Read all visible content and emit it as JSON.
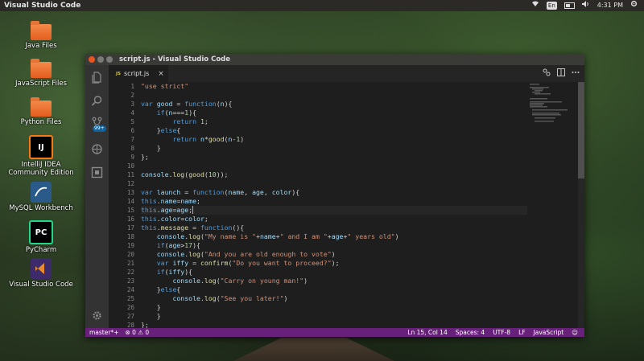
{
  "topbar": {
    "app_title": "Visual Studio Code",
    "keyboard": "En",
    "time": "4:31 PM"
  },
  "desktop": [
    {
      "label": "Java Files",
      "icon": "folder-icon"
    },
    {
      "label": "JavaScript Files",
      "icon": "folder-icon"
    },
    {
      "label": "Python Files",
      "icon": "folder-icon"
    },
    {
      "label": "IntelliJ IDEA Community Edition",
      "icon": "intellij-icon"
    },
    {
      "label": "MySQL Workbench",
      "icon": "mysql-icon"
    },
    {
      "label": "PyCharm",
      "icon": "pycharm-icon"
    },
    {
      "label": "Visual Studio Code",
      "icon": "vscode-icon"
    }
  ],
  "window": {
    "title": "script.js - Visual Studio Code",
    "tab": {
      "badge": "JS",
      "name": "script.js",
      "close": "×"
    },
    "scm_badge": "99+"
  },
  "code": {
    "lines": [
      "1",
      "2",
      "3",
      "4",
      "5",
      "6",
      "7",
      "8",
      "9",
      "10",
      "11",
      "12",
      "13",
      "14",
      "15",
      "16",
      "17",
      "18",
      "19",
      "20",
      "21",
      "22",
      "23",
      "24",
      "25",
      "26",
      "27",
      "28"
    ]
  },
  "statusbar": {
    "branch": "master*+",
    "problems": "⊗ 0 ⚠ 0",
    "position": "Ln 15, Col 14",
    "spaces": "Spaces: 4",
    "encoding": "UTF-8",
    "eol": "LF",
    "language": "JavaScript",
    "smiley": "☺"
  },
  "colors": {
    "accent_status": "#68217a",
    "editor_bg": "#1e1e1e",
    "keyword": "#569cd6",
    "string": "#ce9178",
    "number": "#b5cea8"
  }
}
